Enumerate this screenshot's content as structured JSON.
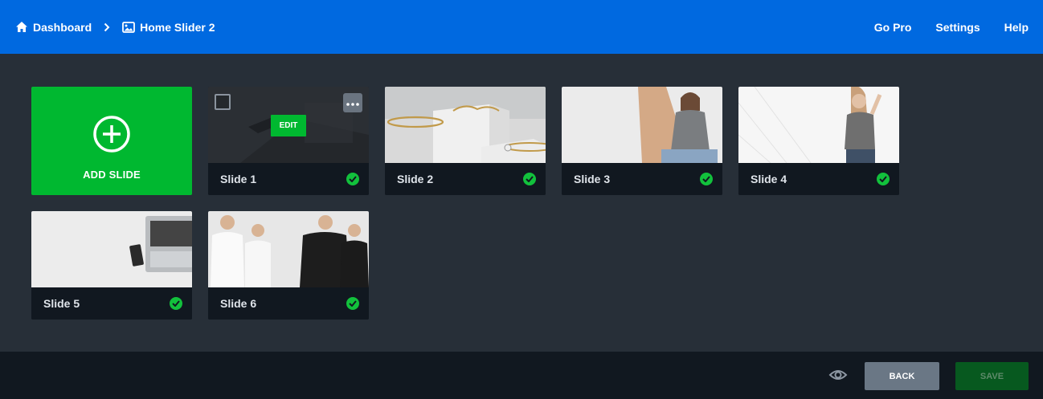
{
  "header": {
    "breadcrumb": [
      {
        "label": "Dashboard",
        "icon": "home-icon"
      },
      {
        "label": "Home Slider 2",
        "icon": "image-icon"
      }
    ],
    "nav": [
      "Go Pro",
      "Settings",
      "Help"
    ]
  },
  "add_slide": {
    "label": "ADD SLIDE",
    "icon": "plus-circle-icon"
  },
  "slides": [
    {
      "label": "Slide 1",
      "status": "published",
      "edit_label": "EDIT",
      "thumb": "dark-abstract"
    },
    {
      "label": "Slide 2",
      "status": "published",
      "thumb": "jewelry-bracelets"
    },
    {
      "label": "Slide 3",
      "status": "published",
      "thumb": "woman-gray-sweater"
    },
    {
      "label": "Slide 4",
      "status": "published",
      "thumb": "woman-tshirt"
    },
    {
      "label": "Slide 5",
      "status": "published",
      "thumb": "laptop-desk"
    },
    {
      "label": "Slide 6",
      "status": "published",
      "thumb": "people-tshirts"
    }
  ],
  "footer": {
    "preview_icon": "eye-icon",
    "back_label": "BACK",
    "save_label": "SAVE"
  },
  "colors": {
    "topbar": "#0069e0",
    "background": "#272f38",
    "accent_green": "#00b830",
    "card_footer": "#111820",
    "status_green": "#12c13c"
  }
}
